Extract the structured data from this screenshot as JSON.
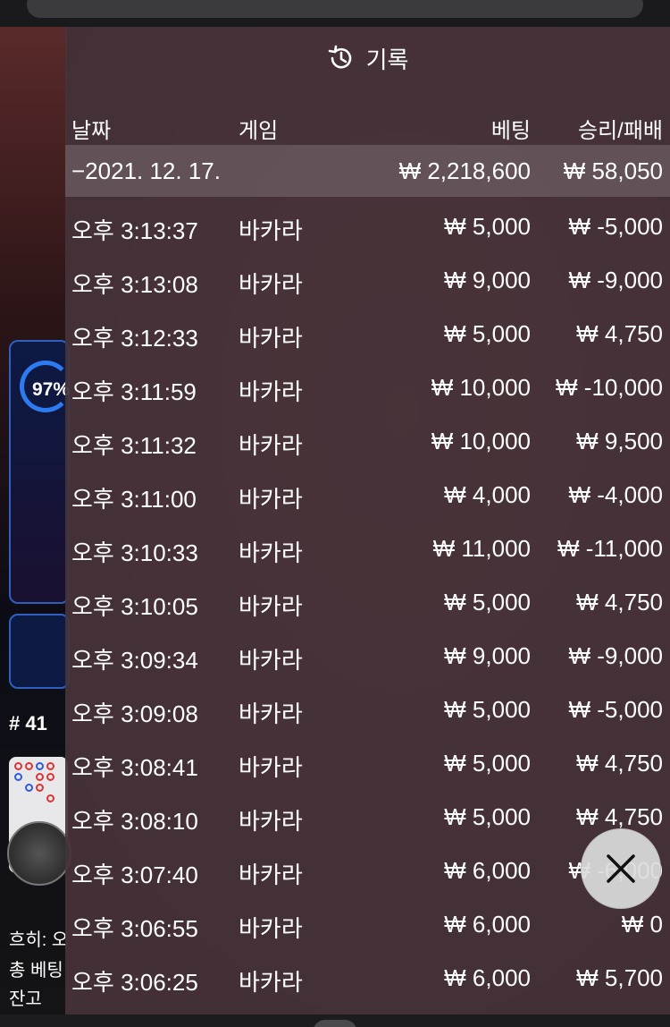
{
  "overlay": {
    "title": "기록",
    "columns": {
      "date": "날짜",
      "game": "게임",
      "bet": "베팅",
      "winloss": "승리/패배"
    },
    "summary": {
      "date": "−2021. 12. 17.",
      "bet": "₩ 2,218,600",
      "winloss": "₩ 58,050"
    },
    "rows": [
      {
        "time": "오후 3:13:37",
        "game": "바카라",
        "bet": "₩ 5,000",
        "winloss": "₩ -5,000"
      },
      {
        "time": "오후 3:13:08",
        "game": "바카라",
        "bet": "₩ 9,000",
        "winloss": "₩ -9,000"
      },
      {
        "time": "오후 3:12:33",
        "game": "바카라",
        "bet": "₩ 5,000",
        "winloss": "₩ 4,750"
      },
      {
        "time": "오후 3:11:59",
        "game": "바카라",
        "bet": "₩ 10,000",
        "winloss": "₩ -10,000"
      },
      {
        "time": "오후 3:11:32",
        "game": "바카라",
        "bet": "₩ 10,000",
        "winloss": "₩ 9,500"
      },
      {
        "time": "오후 3:11:00",
        "game": "바카라",
        "bet": "₩ 4,000",
        "winloss": "₩ -4,000"
      },
      {
        "time": "오후 3:10:33",
        "game": "바카라",
        "bet": "₩ 11,000",
        "winloss": "₩ -11,000"
      },
      {
        "time": "오후 3:10:05",
        "game": "바카라",
        "bet": "₩ 5,000",
        "winloss": "₩ 4,750"
      },
      {
        "time": "오후 3:09:34",
        "game": "바카라",
        "bet": "₩ 9,000",
        "winloss": "₩ -9,000"
      },
      {
        "time": "오후 3:09:08",
        "game": "바카라",
        "bet": "₩ 5,000",
        "winloss": "₩ -5,000"
      },
      {
        "time": "오후 3:08:41",
        "game": "바카라",
        "bet": "₩ 5,000",
        "winloss": "₩ 4,750"
      },
      {
        "time": "오후 3:08:10",
        "game": "바카라",
        "bet": "₩ 5,000",
        "winloss": "₩ 4,750"
      },
      {
        "time": "오후 3:07:40",
        "game": "바카라",
        "bet": "₩ 6,000",
        "winloss": "₩ -6,000"
      },
      {
        "time": "오후 3:06:55",
        "game": "바카라",
        "bet": "₩ 6,000",
        "winloss": "₩ 0"
      },
      {
        "time": "오후 3:06:25",
        "game": "바카라",
        "bet": "₩ 6,000",
        "winloss": "₩ 5,700"
      }
    ]
  },
  "background": {
    "percent": "97%",
    "round": "# 41",
    "line1": "흐히: 오",
    "line2": "총 베팅",
    "line3": "잔고"
  },
  "colors": {
    "panel": "#463a3e",
    "accent_blue": "#2d7bf0"
  }
}
